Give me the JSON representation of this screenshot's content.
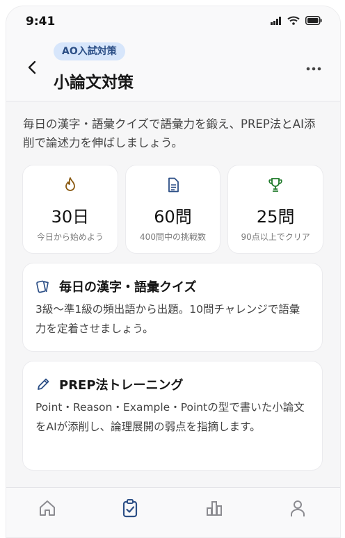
{
  "status_bar": {
    "time": "9:41"
  },
  "header": {
    "badge": "AO入試対策",
    "title": "小論文対策"
  },
  "intro": "毎日の漢字・語彙クイズで語彙力を鍛え、PREP法とAI添削で論述力を伸ばしましょう。",
  "stats": [
    {
      "icon": "flame-icon",
      "value": "30日",
      "label": "今日から始めよう",
      "color": "#8a5a12"
    },
    {
      "icon": "document-icon",
      "value": "60問",
      "label": "400問中の挑戦数",
      "color": "#2c4f86"
    },
    {
      "icon": "trophy-icon",
      "value": "25問",
      "label": "90点以上でクリア",
      "color": "#1f7a2a"
    }
  ],
  "cards": [
    {
      "icon": "cards-icon",
      "title": "毎日の漢字・語彙クイズ",
      "description": "3級〜準1級の頻出語から出題。10問チャレンジで語彙力を定着させましょう。"
    },
    {
      "icon": "pencil-icon",
      "title": "PREP法トレーニング",
      "description": "Point・Reason・Example・Pointの型で書いた小論文をAIが添削し、論理展開の弱点を指摘します。"
    }
  ],
  "nav": {
    "items": [
      {
        "icon": "home-icon",
        "active": false
      },
      {
        "icon": "clipboard-check-icon",
        "active": true
      },
      {
        "icon": "bar-chart-icon",
        "active": false
      },
      {
        "icon": "person-icon",
        "active": false
      }
    ],
    "active_color": "#2c4f86",
    "inactive_color": "#8b8b90"
  }
}
